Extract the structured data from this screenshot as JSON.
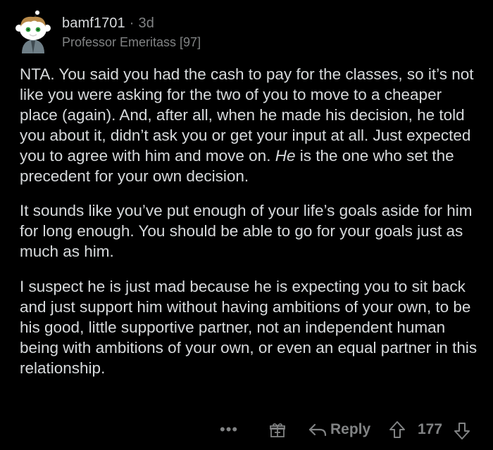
{
  "comment": {
    "username": "bamf1701",
    "separator": "·",
    "age": "3d",
    "flair": "Professor Emeritass [97]",
    "paragraphs": {
      "p1_before": "NTA. You said you had the cash to pay for the classes, so it’s not like you were asking for the two of you to move to a cheaper place (again). And, after all, when he made his decision, he told you about it, didn’t ask you or get your input at all. Just expected you to agree with him and move on. ",
      "p1_emphasis": "He",
      "p1_after": " is the one who set the precedent for your own decision.",
      "p2": "It sounds like you’ve put enough of your life’s goals aside for him for long enough. You should be able to go for your goals just as much as him.",
      "p3": "I suspect he is just mad because he is expecting you to sit back and just support him without having ambitions of your own, to be his good, little supportive partner, not an independent human being with ambitions of your own, or even an equal partner in this relationship."
    }
  },
  "actions": {
    "more_label": "•••",
    "reply_label": "Reply",
    "score": "177"
  },
  "icons": {
    "avatar": "snoo-avatar-icon",
    "award": "award-gift-icon",
    "reply": "reply-arrow-icon",
    "upvote": "upvote-arrow-icon",
    "downvote": "downvote-arrow-icon",
    "more": "more-options-icon"
  },
  "colors": {
    "background": "#000000",
    "text": "#d7dadc",
    "meta": "#818384"
  }
}
